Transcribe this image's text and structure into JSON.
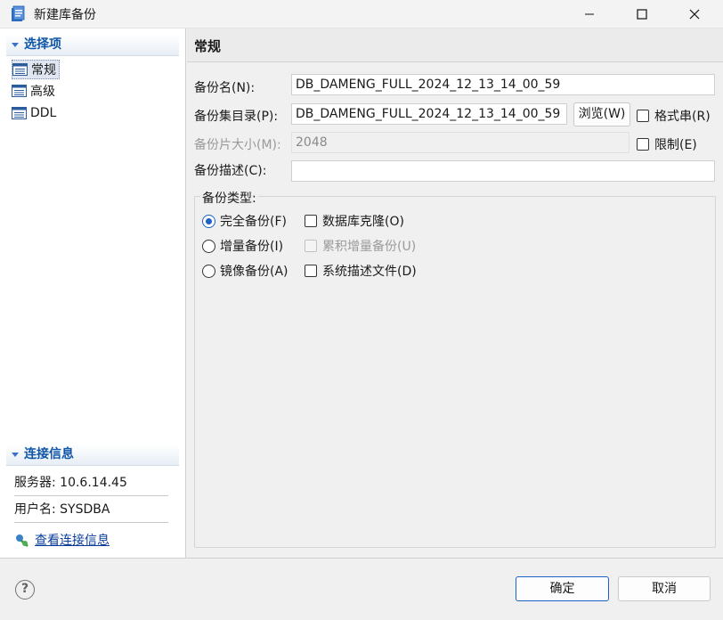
{
  "window": {
    "title": "新建库备份",
    "minimize_glyph": "—",
    "maximize_glyph": "☐",
    "close_glyph": "✕"
  },
  "sidebar": {
    "select_header": "选择项",
    "items": [
      {
        "label": "常规",
        "icon": "list-icon",
        "selected": true
      },
      {
        "label": "高级",
        "icon": "list-icon",
        "selected": false
      },
      {
        "label": "DDL",
        "icon": "list-icon",
        "selected": false
      }
    ],
    "connection_header": "连接信息",
    "server": "服务器: 10.6.14.45",
    "user": "用户名: SYSDBA",
    "view_link": "查看连接信息"
  },
  "main": {
    "page_title": "常规",
    "backup_name_label": "备份名(N):",
    "backup_name_value": "DB_DAMENG_FULL_2024_12_13_14_00_59",
    "backup_dir_label": "备份集目录(P):",
    "backup_dir_value": "DB_DAMENG_FULL_2024_12_13_14_00_59",
    "browse_label": "浏览(W)",
    "format_label": "格式串(R)",
    "piece_size_label": "备份片大小(M):",
    "piece_size_value": "2048",
    "limit_label": "限制(E)",
    "desc_label": "备份描述(C):",
    "desc_value": "",
    "type_group_title": "备份类型:",
    "full_label": "完全备份(F)",
    "incr_label": "增量备份(I)",
    "mirror_label": "镜像备份(A)",
    "clone_label": "数据库克隆(O)",
    "cumulative_label": "累积增量备份(U)",
    "sysdesc_label": "系统描述文件(D)",
    "selected_type": "full"
  },
  "footer": {
    "help_glyph": "?",
    "ok_label": "确定",
    "cancel_label": "取消"
  },
  "colors": {
    "accent": "#1e62c4",
    "header_text": "#0f56a8",
    "link": "#0a3c9c"
  }
}
